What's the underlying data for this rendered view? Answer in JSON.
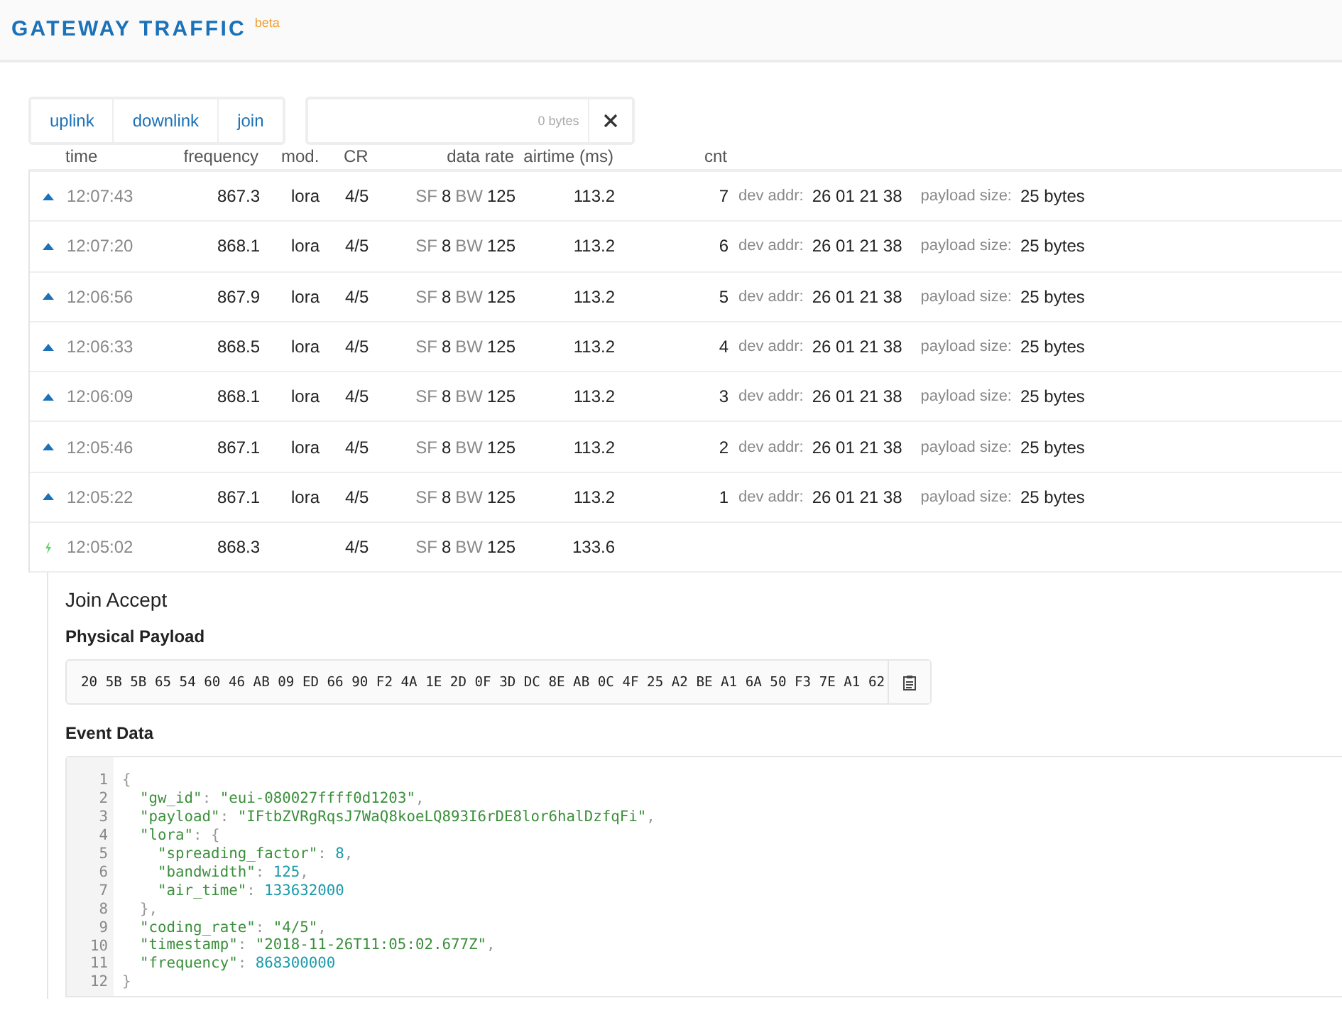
{
  "header": {
    "title": "GATEWAY TRAFFIC",
    "badge": "beta"
  },
  "filters": [
    {
      "label": "uplink",
      "selected": false
    },
    {
      "label": "downlink",
      "selected": false
    },
    {
      "label": "join",
      "selected": false
    }
  ],
  "search": {
    "byte_count": "0 bytes"
  },
  "table": {
    "columns": [
      "time",
      "frequency",
      "mod.",
      "CR",
      "data rate",
      "airtime (ms)",
      "cnt"
    ],
    "rows": [
      {
        "kind": "uplink",
        "time": "12:07:43",
        "frequency": "867.3",
        "modulation": "lora",
        "coding_rate": "4/5",
        "sf_label": "SF",
        "sf": "8",
        "bw_label": "BW",
        "bw": "125",
        "airtime": "113.2",
        "count": "7",
        "dev_addr_label": "dev addr:",
        "dev_addr": "26 01 21 38",
        "payload_size_label": "payload size:",
        "payload_size": "25 bytes"
      },
      {
        "kind": "uplink",
        "time": "12:07:20",
        "frequency": "868.1",
        "modulation": "lora",
        "coding_rate": "4/5",
        "sf_label": "SF",
        "sf": "8",
        "bw_label": "BW",
        "bw": "125",
        "airtime": "113.2",
        "count": "6",
        "dev_addr_label": "dev addr:",
        "dev_addr": "26 01 21 38",
        "payload_size_label": "payload size:",
        "payload_size": "25 bytes"
      },
      {
        "kind": "uplink",
        "time": "12:06:56",
        "frequency": "867.9",
        "modulation": "lora",
        "coding_rate": "4/5",
        "sf_label": "SF",
        "sf": "8",
        "bw_label": "BW",
        "bw": "125",
        "airtime": "113.2",
        "count": "5",
        "dev_addr_label": "dev addr:",
        "dev_addr": "26 01 21 38",
        "payload_size_label": "payload size:",
        "payload_size": "25 bytes"
      },
      {
        "kind": "uplink",
        "time": "12:06:33",
        "frequency": "868.5",
        "modulation": "lora",
        "coding_rate": "4/5",
        "sf_label": "SF",
        "sf": "8",
        "bw_label": "BW",
        "bw": "125",
        "airtime": "113.2",
        "count": "4",
        "dev_addr_label": "dev addr:",
        "dev_addr": "26 01 21 38",
        "payload_size_label": "payload size:",
        "payload_size": "25 bytes"
      },
      {
        "kind": "uplink",
        "time": "12:06:09",
        "frequency": "868.1",
        "modulation": "lora",
        "coding_rate": "4/5",
        "sf_label": "SF",
        "sf": "8",
        "bw_label": "BW",
        "bw": "125",
        "airtime": "113.2",
        "count": "3",
        "dev_addr_label": "dev addr:",
        "dev_addr": "26 01 21 38",
        "payload_size_label": "payload size:",
        "payload_size": "25 bytes"
      },
      {
        "kind": "uplink",
        "time": "12:05:46",
        "frequency": "867.1",
        "modulation": "lora",
        "coding_rate": "4/5",
        "sf_label": "SF",
        "sf": "8",
        "bw_label": "BW",
        "bw": "125",
        "airtime": "113.2",
        "count": "2",
        "dev_addr_label": "dev addr:",
        "dev_addr": "26 01 21 38",
        "payload_size_label": "payload size:",
        "payload_size": "25 bytes"
      },
      {
        "kind": "uplink",
        "time": "12:05:22",
        "frequency": "867.1",
        "modulation": "lora",
        "coding_rate": "4/5",
        "sf_label": "SF",
        "sf": "8",
        "bw_label": "BW",
        "bw": "125",
        "airtime": "113.2",
        "count": "1",
        "dev_addr_label": "dev addr:",
        "dev_addr": "26 01 21 38",
        "payload_size_label": "payload size:",
        "payload_size": "25 bytes"
      },
      {
        "kind": "join",
        "time": "12:05:02",
        "frequency": "868.3",
        "coding_rate": "4/5",
        "sf_label": "SF",
        "sf": "8",
        "bw_label": "BW",
        "bw": "125",
        "airtime": "133.6"
      }
    ]
  },
  "detail": {
    "title": "Join Accept",
    "payload_heading": "Physical Payload",
    "payload": "20 5B 5B 65 54 60 46 AB 09 ED 66 90 F2 4A 1E 2D 0F 3D DC 8E AB 0C 4F 25 A2 BE A1 6A 50 F3 7E A1 62",
    "event_heading": "Event Data",
    "code": [
      {
        "number": "1",
        "parts": [
          {
            "kind": "punct",
            "text": "{"
          }
        ]
      },
      {
        "number": "2",
        "parts": [
          {
            "kind": "key",
            "text": "  \"gw_id\""
          },
          {
            "kind": "punct",
            "text": ": "
          },
          {
            "kind": "string",
            "text": "\"eui-080027ffff0d1203\""
          },
          {
            "kind": "punct",
            "text": ","
          }
        ]
      },
      {
        "number": "3",
        "parts": [
          {
            "kind": "key",
            "text": "  \"payload\""
          },
          {
            "kind": "punct",
            "text": ": "
          },
          {
            "kind": "string",
            "text": "\"IFtbZVRgRqsJ7WaQ8koeLQ893I6rDE8lor6halDzfqFi\""
          },
          {
            "kind": "punct",
            "text": ","
          }
        ]
      },
      {
        "number": "4",
        "parts": [
          {
            "kind": "key",
            "text": "  \"lora\""
          },
          {
            "kind": "punct",
            "text": ": {"
          }
        ]
      },
      {
        "number": "5",
        "parts": [
          {
            "kind": "key",
            "text": "    \"spreading_factor\""
          },
          {
            "kind": "punct",
            "text": ": "
          },
          {
            "kind": "number",
            "text": "8"
          },
          {
            "kind": "punct",
            "text": ","
          }
        ]
      },
      {
        "number": "6",
        "parts": [
          {
            "kind": "key",
            "text": "    \"bandwidth\""
          },
          {
            "kind": "punct",
            "text": ": "
          },
          {
            "kind": "number",
            "text": "125"
          },
          {
            "kind": "punct",
            "text": ","
          }
        ]
      },
      {
        "number": "7",
        "parts": [
          {
            "kind": "key",
            "text": "    \"air_time\""
          },
          {
            "kind": "punct",
            "text": ": "
          },
          {
            "kind": "number",
            "text": "133632000"
          }
        ]
      },
      {
        "number": "8",
        "parts": [
          {
            "kind": "punct",
            "text": "  },"
          }
        ]
      },
      {
        "number": "9",
        "parts": [
          {
            "kind": "key",
            "text": "  \"coding_rate\""
          },
          {
            "kind": "punct",
            "text": ": "
          },
          {
            "kind": "string",
            "text": "\"4/5\""
          },
          {
            "kind": "punct",
            "text": ","
          }
        ]
      },
      {
        "number": "10",
        "parts": [
          {
            "kind": "key",
            "text": "  \"timestamp\""
          },
          {
            "kind": "punct",
            "text": ": "
          },
          {
            "kind": "string",
            "text": "\"2018-11-26T11:05:02.677Z\""
          },
          {
            "kind": "punct",
            "text": ","
          }
        ]
      },
      {
        "number": "11",
        "parts": [
          {
            "kind": "key",
            "text": "  \"frequency\""
          },
          {
            "kind": "punct",
            "text": ": "
          },
          {
            "kind": "number",
            "text": "868300000"
          }
        ]
      },
      {
        "number": "12",
        "parts": [
          {
            "kind": "punct",
            "text": "}"
          }
        ]
      }
    ]
  }
}
